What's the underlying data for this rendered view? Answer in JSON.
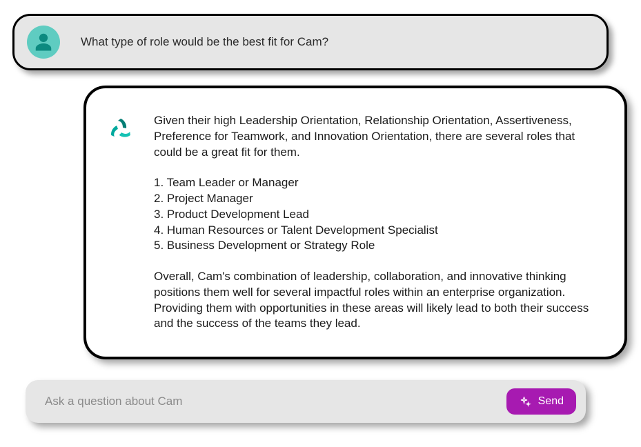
{
  "user_message": {
    "text": "What type of role would be the best fit for Cam?"
  },
  "ai_message": {
    "intro": "Given their high Leadership Orientation, Relationship Orientation, Assertiveness, Preference for Teamwork, and Innovation Orientation, there are several roles that could be a great fit for them.",
    "list": [
      "1. Team Leader or Manager",
      "2. Project Manager",
      "3. Product Development Lead",
      "4. Human Resources or Talent Development Specialist",
      "5. Business Development or Strategy Role"
    ],
    "outro": "Overall, Cam's combination of leadership, collaboration, and innovative thinking positions them well for several impactful roles within an enterprise organization. Providing them with opportunities in these areas will likely lead to both their success and the success of the teams they lead."
  },
  "input": {
    "placeholder": "Ask a question about Cam",
    "send_label": "Send"
  },
  "colors": {
    "accent_teal": "#00a99d",
    "accent_purple": "#a71ab1",
    "avatar_bg": "#5fccc1"
  }
}
